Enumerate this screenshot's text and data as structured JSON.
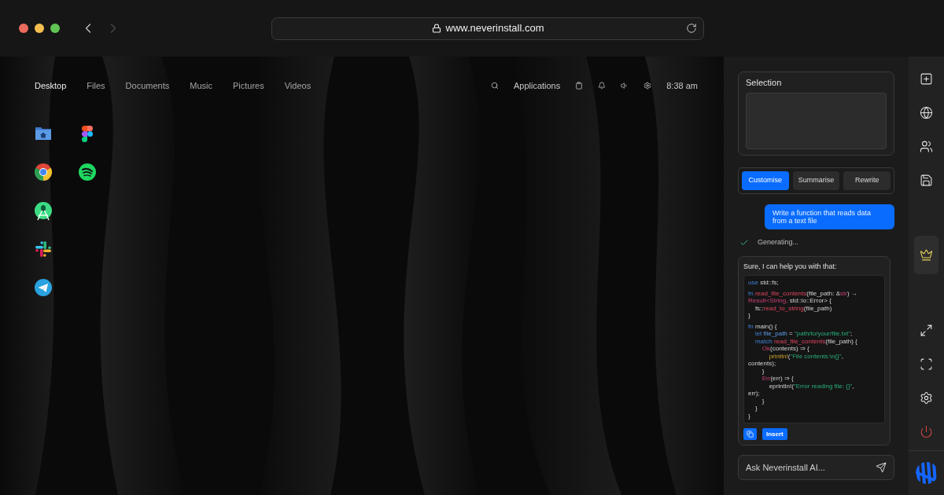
{
  "browser": {
    "back": {
      "disabled": false
    },
    "forward": {
      "disabled": true
    },
    "url": "www.neverinstall.com"
  },
  "desktop": {
    "menu": [
      {
        "label": "Desktop",
        "selected": true
      },
      {
        "label": "Files",
        "selected": false
      },
      {
        "label": "Documents",
        "selected": false
      },
      {
        "label": "Music",
        "selected": false
      },
      {
        "label": "Pictures",
        "selected": false
      },
      {
        "label": "Videos",
        "selected": false
      }
    ],
    "status_bar": {
      "applications": "Applications",
      "time": "8:38 am"
    }
  },
  "assistant": {
    "selection": {
      "title": "Selection"
    },
    "modes": [
      {
        "label": "Customise",
        "selected": true
      },
      {
        "label": "Summarise",
        "selected": false
      },
      {
        "label": "Rewrite",
        "selected": false
      }
    ],
    "prompt": "Write a function that reads data from a text file",
    "status": "Generating...",
    "reply": {
      "intro": "Sure, I can help you with that:",
      "code": [
        [
          [
            {
              "text": "use",
              "kind": "keyword"
            },
            {
              "text": " std::fs;",
              "kind": "plain"
            }
          ]
        ],
        [
          [
            {
              "text": "fn",
              "kind": "keyword"
            },
            {
              "text": " read_file_contents",
              "kind": "function"
            },
            {
              "text": "(file_path: &",
              "kind": "plain"
            },
            {
              "text": "str",
              "kind": "type"
            },
            {
              "text": ") →",
              "kind": "plain"
            }
          ],
          [
            {
              "text": "Result<String,",
              "kind": "type"
            },
            {
              "text": " std::io::Error> {",
              "kind": "plain"
            }
          ],
          [
            {
              "text": "    fs::",
              "kind": "plain"
            },
            {
              "text": "read_to_string",
              "kind": "function"
            },
            {
              "text": "(file_path)",
              "kind": "plain"
            }
          ],
          [
            {
              "text": "}",
              "kind": "plain"
            }
          ]
        ],
        [
          [
            {
              "text": "fn",
              "kind": "keyword"
            },
            {
              "text": " main() {",
              "kind": "plain"
            }
          ],
          [
            {
              "text": "    let",
              "kind": "keyword"
            },
            {
              "text": " file_path",
              "kind": "variable"
            },
            {
              "text": " = ",
              "kind": "plain"
            },
            {
              "text": "\"path/to/your/file.txt\"",
              "kind": "string"
            },
            {
              "text": ";",
              "kind": "plain"
            }
          ],
          [
            {
              "text": "    match",
              "kind": "keyword"
            },
            {
              "text": " read_file_contents",
              "kind": "function"
            },
            {
              "text": "(file_path) {",
              "kind": "plain"
            }
          ],
          [
            {
              "text": "        Ok",
              "kind": "type"
            },
            {
              "text": "(contents) ⇒ {",
              "kind": "plain"
            }
          ],
          [
            {
              "text": "            println!",
              "kind": "macro"
            },
            {
              "text": "(",
              "kind": "plain"
            },
            {
              "text": "\"File contents:\\n{}\"",
              "kind": "string"
            },
            {
              "text": ",",
              "kind": "plain"
            }
          ],
          [
            {
              "text": "contents);",
              "kind": "plain"
            }
          ],
          [
            {
              "text": "        }",
              "kind": "plain"
            }
          ],
          [
            {
              "text": "        Err",
              "kind": "type"
            },
            {
              "text": "(err) ⇒ {",
              "kind": "plain"
            }
          ],
          [
            {
              "text": "            eprintln!(",
              "kind": "plain"
            },
            {
              "text": "\"Error reading file: {}\"",
              "kind": "string"
            },
            {
              "text": ",",
              "kind": "plain"
            }
          ],
          [
            {
              "text": "err);",
              "kind": "plain"
            }
          ],
          [
            {
              "text": "        }",
              "kind": "plain"
            }
          ],
          [
            {
              "text": "    }",
              "kind": "plain"
            }
          ],
          [
            {
              "text": "}",
              "kind": "plain"
            }
          ]
        ]
      ],
      "insert": "Insert"
    },
    "input": {
      "placeholder": "Ask Neverinstall AI..."
    }
  },
  "sidebar": {
    "groups": [
      {
        "items": [
          {
            "kind": "add",
            "selected": false
          },
          {
            "kind": "globe",
            "selected": false
          },
          {
            "kind": "users",
            "selected": false
          },
          {
            "kind": "save",
            "selected": false
          }
        ]
      },
      {
        "items": [
          {
            "kind": "crown",
            "selected": true
          }
        ]
      },
      {
        "items": [
          {
            "kind": "expand",
            "selected": false
          },
          {
            "kind": "fullscreen",
            "selected": false
          },
          {
            "kind": "settings",
            "selected": false
          },
          {
            "kind": "power",
            "selected": false
          }
        ]
      }
    ]
  }
}
